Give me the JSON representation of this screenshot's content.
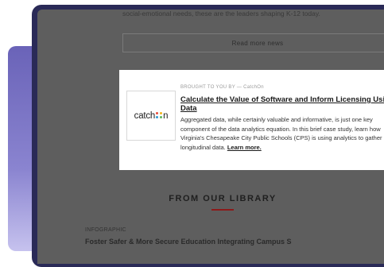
{
  "intro_text": "social-emotional needs, these are the leaders shaping K-12 today.",
  "read_more_label": "Read more news",
  "sponsored": {
    "sponsor_line": "BROUGHT TO YOU BY — CatchOn",
    "logo_text_left": "catch",
    "logo_text_right": "n",
    "title": "Calculate the Value of Software and Inform Licensing Using Data",
    "body": "Aggregated data, while certainly valuable and informative, is just one key component of the data analytics equation. In this brief case study, learn how Virginia's Chesapeake City Public Schools (CPS) is using analytics to gather longitudinal data.",
    "learn_more": "Learn more."
  },
  "library": {
    "title": "FROM OUR LIBRARY",
    "rule_color": "#8c1a1a",
    "kicker": "INFOGRAPHIC",
    "next_title": "Foster Safer & More Secure Education Integrating Campus S"
  },
  "colors": {
    "frame": "#2a2a57",
    "overlay": "#5e5e5e",
    "accent_purple": "#6a63b8",
    "logo_dots": [
      "#e84b3a",
      "#f2b31b",
      "#2f9bd6",
      "#5bb85c"
    ]
  }
}
